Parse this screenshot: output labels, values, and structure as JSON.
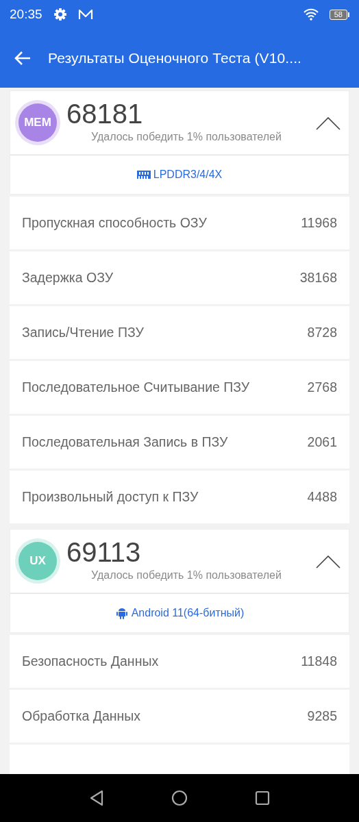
{
  "status_bar": {
    "time": "20:35",
    "battery": "58"
  },
  "app_bar": {
    "title": "Результаты Оценочного Теста (V10...."
  },
  "sections": [
    {
      "badge": "MEM",
      "color": "#a884e6",
      "score": "68181",
      "subtitle": "Удалось победить 1% пользователей",
      "expanded": true,
      "tag": {
        "kind": "memory",
        "text": "LPDDR3/4/4X"
      },
      "rows": [
        {
          "label": "Пропускная способность ОЗУ",
          "value": "11968"
        },
        {
          "label": "Задержка ОЗУ",
          "value": "38168"
        },
        {
          "label": "Запись/Чтение ПЗУ",
          "value": "8728"
        },
        {
          "label": "Последовательное Считывание ПЗУ",
          "value": "2768"
        },
        {
          "label": "Последовательная Запись в ПЗУ",
          "value": "2061"
        },
        {
          "label": "Произвольный доступ к ПЗУ",
          "value": "4488"
        }
      ]
    },
    {
      "badge": "UX",
      "color": "#6dd0bb",
      "score": "69113",
      "subtitle": "Удалось победить 1% пользователей",
      "expanded": true,
      "tag": {
        "kind": "android",
        "text": "Android 11(64-битный)"
      },
      "rows": [
        {
          "label": "Безопасность Данных",
          "value": "11848"
        },
        {
          "label": "Обработка Данных",
          "value": "9285"
        }
      ]
    }
  ]
}
